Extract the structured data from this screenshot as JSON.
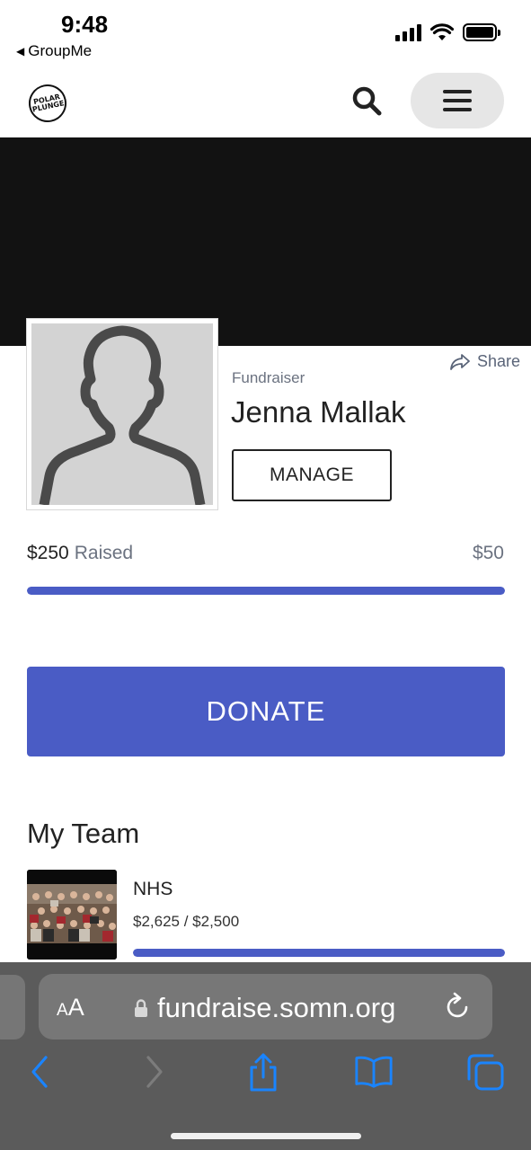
{
  "status_bar": {
    "time": "9:48",
    "back_app": "GroupMe",
    "icons": [
      "signal-icon",
      "wifi-icon",
      "battery-icon"
    ]
  },
  "header": {
    "logo_line1": "POLAR",
    "logo_line2": "PLUNGE",
    "search_icon": "search-icon",
    "menu_icon": "hamburger-menu-icon"
  },
  "profile": {
    "role": "Fundraiser",
    "name": "Jenna Mallak",
    "manage_label": "MANAGE",
    "share_label": "Share"
  },
  "progress": {
    "raised_amount": "$250",
    "raised_label": "Raised",
    "goal": "$50",
    "fraction": 1.0
  },
  "donate_label": "DONATE",
  "team": {
    "heading": "My Team",
    "name": "NHS",
    "amounts": "$2,625 / $2,500",
    "fraction": 1.0
  },
  "browser": {
    "aa_small": "A",
    "aa_big": "A",
    "url": "fundraise.somn.org",
    "nav_icons": [
      "back-icon",
      "forward-icon",
      "share-icon",
      "bookmarks-icon",
      "tabs-icon"
    ]
  },
  "colors": {
    "accent": "#4a5cc5",
    "hero": "#121212",
    "toolbar": "#5b5b5b",
    "ios_blue": "#1a84ff"
  }
}
